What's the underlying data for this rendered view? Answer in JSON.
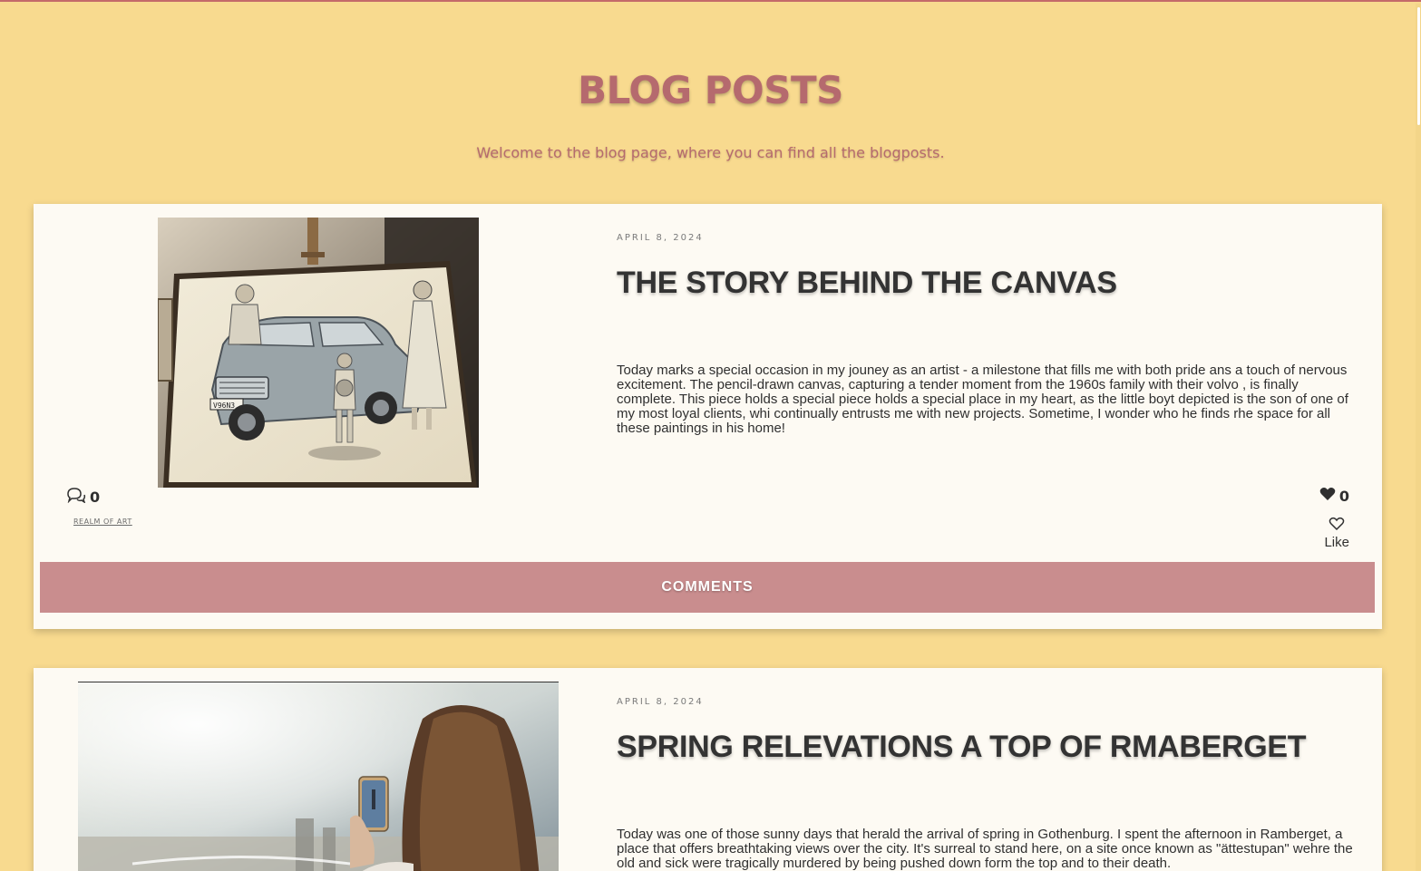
{
  "header": {
    "title": "BLOG POSTS",
    "subtitle": "Welcome to the blog page, where you can find all the blogposts."
  },
  "posts": [
    {
      "date": "APRIL 8, 2024",
      "title": "THE STORY BEHIND THE CANVAS",
      "body": "Today marks a special occasion in my jouney as an artist - a milestone that fills me with both pride ans a touch of nervous excitement. The pencil-drawn canvas, capturing a tender moment from the 1960s family with their volvo , is finally complete.  This piece holds a special piece holds a special place in my heart, as the little boyt depicted is the son of one of my most loyal clients, whi continually entrusts me with new projects. Sometime, I wonder who he finds rhe space for all these paintings in his home!",
      "comment_count": "0",
      "category": "REALM OF ART",
      "like_count": "0",
      "like_label": "Like",
      "comments_button": "COMMENTS",
      "image_plate": "V96N3"
    },
    {
      "date": "APRIL 8, 2024",
      "title": "SPRING RELEVATIONS A TOP OF RMABERGET",
      "body": "Today was one of those sunny days that herald the arrival of spring in Gothenburg. I spent the afternoon in Ramberget, a place that offers breathtaking views over the city. It's surreal to stand here, on a site once known as \"ättestupan\" wehre the old and sick were tragically murdered by being pushed down form the top and to their death."
    }
  ],
  "colors": {
    "background": "#f8da8f",
    "accent": "#b56a6e",
    "card": "#fdfaf3",
    "button": "#c98d8e"
  }
}
